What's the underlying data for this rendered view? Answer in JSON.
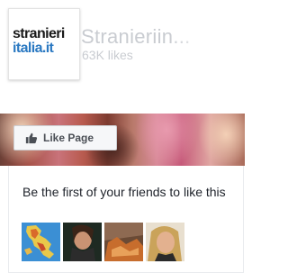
{
  "page": {
    "name": "Stranieriin...",
    "likes": "63K likes",
    "logo": {
      "line1": "stranieri",
      "line2": "italia.it",
      "accent_color": "#2b79c2"
    }
  },
  "like_button": {
    "label": "Like Page",
    "icon": "thumbs-up-icon"
  },
  "friends": {
    "text": "Be the first of your friends to like this",
    "thumbnails": [
      {
        "name": "friend-thumb-map"
      },
      {
        "name": "friend-thumb-portrait-1"
      },
      {
        "name": "friend-thumb-portrait-2"
      },
      {
        "name": "friend-thumb-portrait-3"
      }
    ]
  },
  "colors": {
    "muted_text": "#c9ccd1",
    "button_text": "#4b4f56",
    "body_text": "#1d2129"
  }
}
